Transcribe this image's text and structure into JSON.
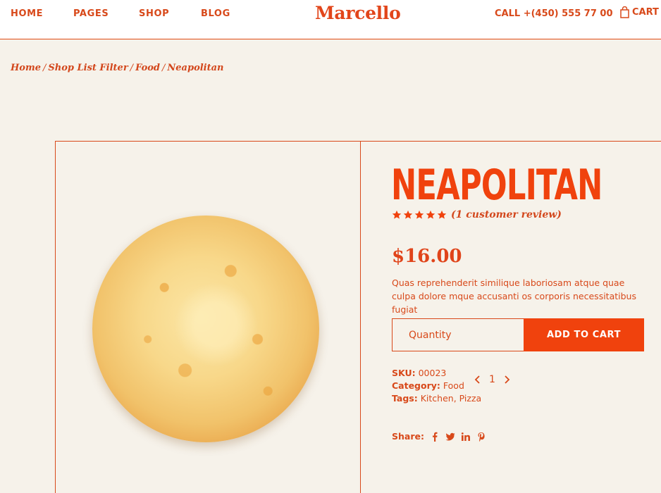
{
  "header": {
    "nav": [
      "HOME",
      "PAGES",
      "SHOP",
      "BLOG"
    ],
    "logo": "Marcello",
    "call": "CALL +(450) 555 77 00",
    "cart": "CART",
    "cart_icon": "shopping-bag-icon"
  },
  "breadcrumb": [
    "Home",
    "Shop List Filter",
    "Food",
    "Neapolitan"
  ],
  "product": {
    "title": "NEAPOLITAN",
    "rating": 5,
    "review_text": "(1 customer review)",
    "price": "$16.00",
    "description": "Quas reprehenderit similique laboriosam atque quae culpa dolore mque accusanti os corporis necessitatibus fugiat",
    "quantity_placeholder": "Quantity",
    "add_to_cart": "ADD TO CART",
    "sku_label": "SKU:",
    "sku": "00023",
    "category_label": "Category:",
    "category": "Food",
    "tags_label": "Tags:",
    "tags": "Kitchen, Pizza",
    "quantity_value": "1",
    "share_label": "Share:",
    "share_icons": [
      "facebook-icon",
      "twitter-icon",
      "linkedin-icon",
      "pinterest-icon"
    ]
  },
  "colors": {
    "accent": "#f0420d",
    "text": "#d8491a",
    "background": "#f6f2ea"
  }
}
